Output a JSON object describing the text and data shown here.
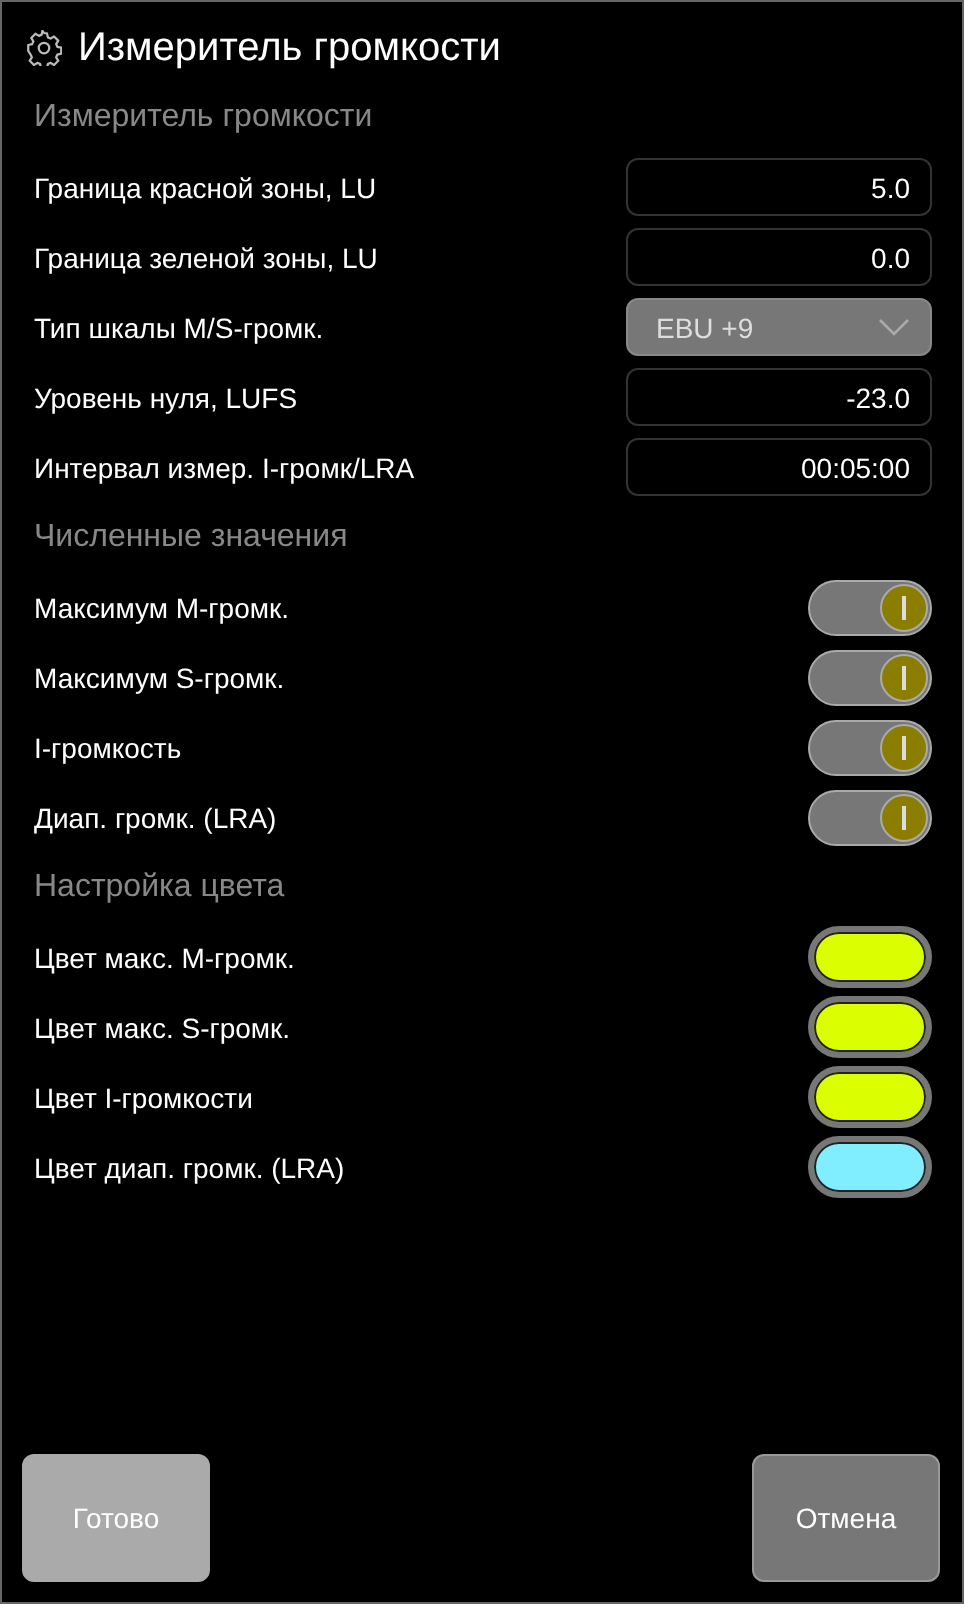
{
  "window": {
    "title": "Измеритель громкости"
  },
  "sections": [
    {
      "title": "Измеритель громкости",
      "items": [
        {
          "kind": "field",
          "label": "Граница красной зоны, LU",
          "value": "5.0"
        },
        {
          "kind": "field",
          "label": "Граница зеленой зоны, LU",
          "value": "0.0"
        },
        {
          "kind": "select",
          "label": "Тип шкалы M/S-громк.",
          "value": "EBU +9"
        },
        {
          "kind": "field",
          "label": "Уровень нуля, LUFS",
          "value": "-23.0"
        },
        {
          "kind": "field",
          "label": "Интервал измер. I-громк/LRA",
          "value": "00:05:00"
        }
      ]
    },
    {
      "title": "Численные значения",
      "items": [
        {
          "kind": "toggle",
          "label": "Максимум M-громк.",
          "on": true
        },
        {
          "kind": "toggle",
          "label": "Максимум S-громк.",
          "on": true
        },
        {
          "kind": "toggle",
          "label": "I-громкость",
          "on": true
        },
        {
          "kind": "toggle",
          "label": "Диап. громк. (LRA)",
          "on": true
        }
      ]
    },
    {
      "title": "Настройка цвета",
      "items": [
        {
          "kind": "color",
          "label": "Цвет макс. M-громк.",
          "color": "#dcff00"
        },
        {
          "kind": "color",
          "label": "Цвет макс. S-громк.",
          "color": "#dcff00"
        },
        {
          "kind": "color",
          "label": "Цвет I-громкости",
          "color": "#dcff00"
        },
        {
          "kind": "color",
          "label": "Цвет диап. громк. (LRA)",
          "color": "#80eeff"
        }
      ]
    }
  ],
  "buttons": [
    {
      "label": "Готово",
      "disabled": true
    },
    {
      "label": "Отмена",
      "disabled": false
    }
  ]
}
